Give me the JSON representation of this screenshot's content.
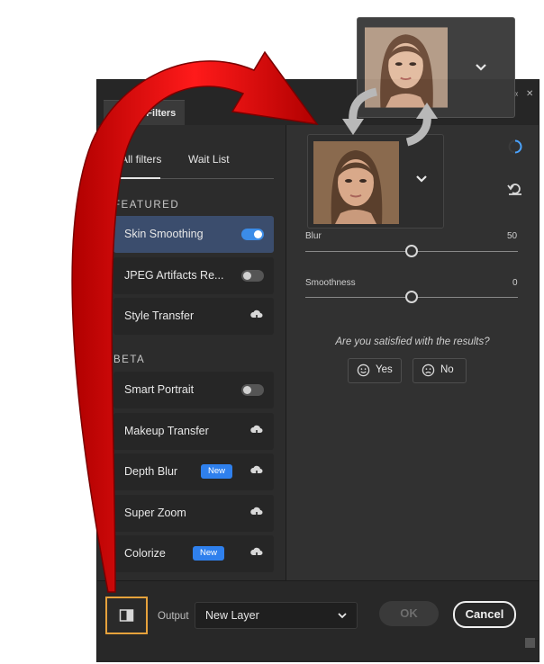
{
  "window": {
    "tab_title": "Neural Filters"
  },
  "filter_tabs": {
    "all": "All filters",
    "wait": "Wait List"
  },
  "sections": {
    "featured": "FEATURED",
    "beta": "BETA"
  },
  "filters": [
    {
      "label": "Skin Smoothing",
      "control": "toggle",
      "state": "on"
    },
    {
      "label": "JPEG Artifacts Re...",
      "control": "toggle",
      "state": "off"
    },
    {
      "label": "Style Transfer",
      "control": "cloud-download-icon"
    },
    {
      "label": "Smart Portrait",
      "control": "toggle",
      "state": "off"
    },
    {
      "label": "Makeup Transfer",
      "control": "cloud-download-icon"
    },
    {
      "label": "Depth Blur",
      "badge": "New",
      "control": "cloud-download-icon"
    },
    {
      "label": "Super Zoom",
      "control": "cloud-download-icon"
    },
    {
      "label": "Colorize",
      "badge": "New",
      "control": "cloud-download-icon"
    }
  ],
  "settings": {
    "blur": {
      "label": "Blur",
      "value": "50",
      "fraction": 0.5
    },
    "smoothness": {
      "label": "Smoothness",
      "value": "0",
      "fraction": 0.5
    }
  },
  "feedback": {
    "question": "Are you satisfied with the results?",
    "yes": "Yes",
    "no": "No"
  },
  "footer": {
    "output_label": "Output",
    "output_value": "New Layer",
    "ok": "OK",
    "cancel": "Cancel"
  },
  "colors": {
    "accent": "#3b8ce8",
    "selected_bg": "#3b4d6d",
    "highlight_box": "#e6a23c",
    "annotation_arrow": "#e01010"
  },
  "icons": [
    "chevron-down-icon",
    "loading-spinner-icon",
    "reset-icon",
    "cloud-download-icon",
    "smiley-happy-icon",
    "smiley-sad-icon",
    "compare-icon"
  ]
}
